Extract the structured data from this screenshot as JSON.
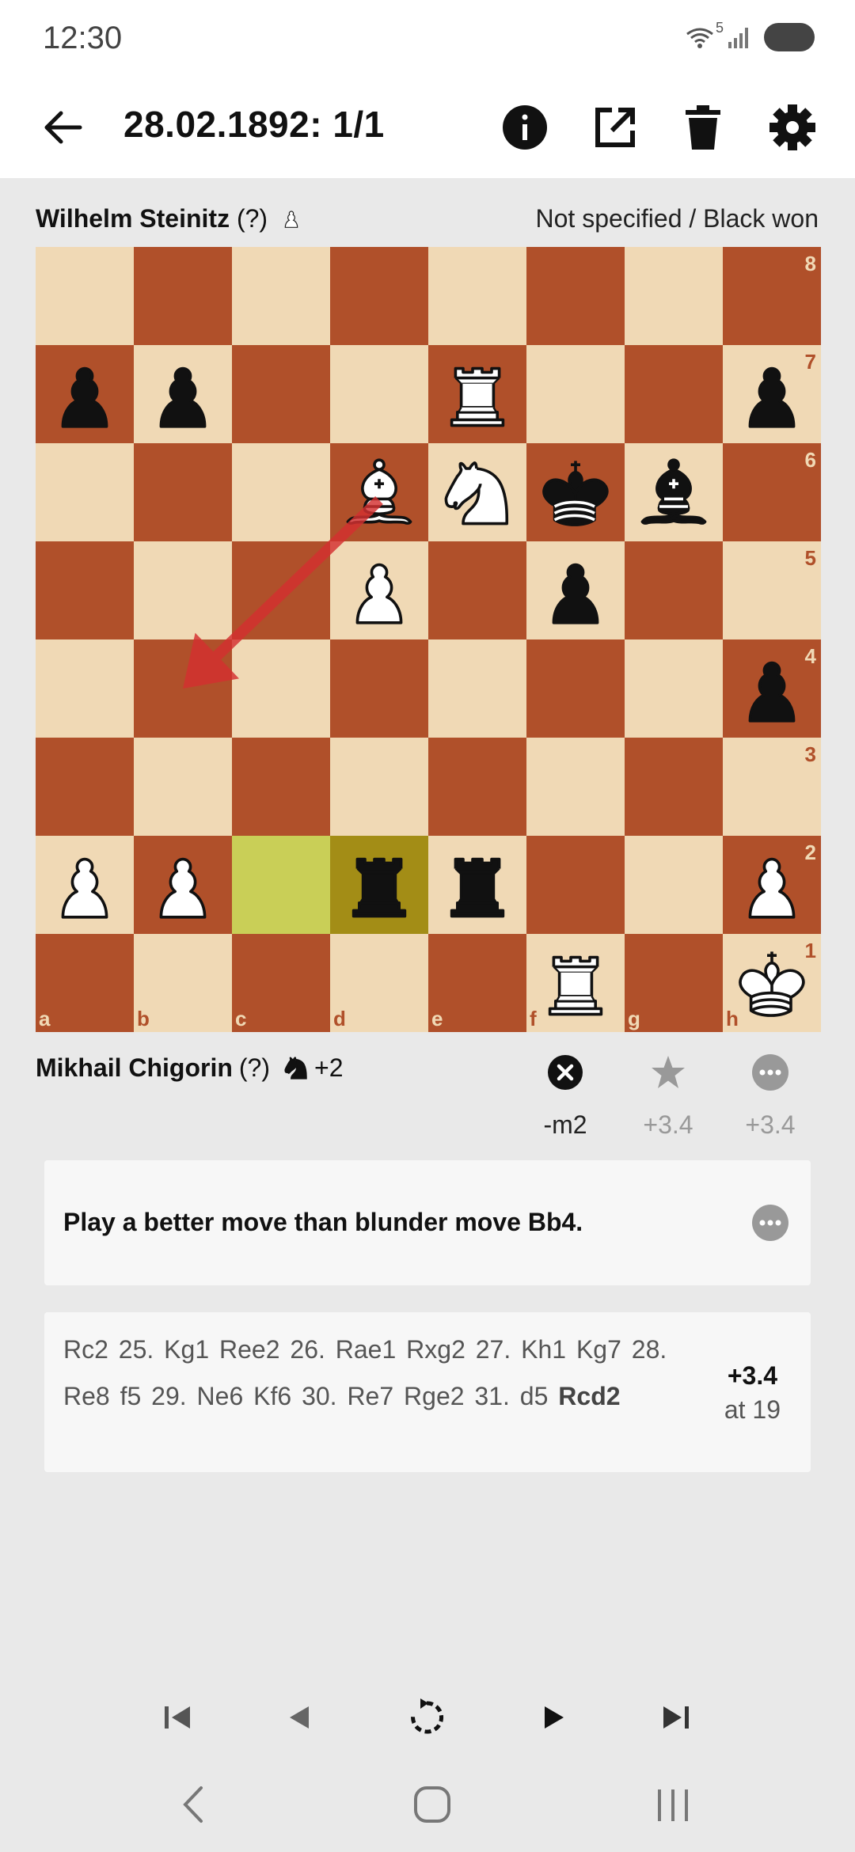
{
  "status": {
    "time": "12:30",
    "wifi_badge": "5"
  },
  "app_bar": {
    "title": "28.02.1892: 1/1",
    "icons": [
      "back-arrow-icon",
      "info-icon",
      "open-external-icon",
      "delete-icon",
      "settings-icon"
    ]
  },
  "top_player": {
    "name": "Wilhelm Steinitz",
    "rating": "(?)",
    "side_icon": "white-pawn-icon"
  },
  "game_result": "Not specified / Black won",
  "board": {
    "files": [
      "a",
      "b",
      "c",
      "d",
      "e",
      "f",
      "g",
      "h"
    ],
    "ranks": [
      "8",
      "7",
      "6",
      "5",
      "4",
      "3",
      "2",
      "1"
    ],
    "pieces": [
      {
        "sq": "a7",
        "p": "bP"
      },
      {
        "sq": "b7",
        "p": "bP"
      },
      {
        "sq": "e7",
        "p": "wR"
      },
      {
        "sq": "h7",
        "p": "bP"
      },
      {
        "sq": "d6",
        "p": "wB"
      },
      {
        "sq": "e6",
        "p": "wN"
      },
      {
        "sq": "f6",
        "p": "bK"
      },
      {
        "sq": "g6",
        "p": "bB"
      },
      {
        "sq": "d5",
        "p": "wP"
      },
      {
        "sq": "f5",
        "p": "bP"
      },
      {
        "sq": "h4",
        "p": "bP"
      },
      {
        "sq": "a2",
        "p": "wP"
      },
      {
        "sq": "b2",
        "p": "wP"
      },
      {
        "sq": "d2",
        "p": "bR"
      },
      {
        "sq": "e2",
        "p": "bR"
      },
      {
        "sq": "h2",
        "p": "wP"
      },
      {
        "sq": "f1",
        "p": "wR"
      },
      {
        "sq": "h1",
        "p": "wK"
      }
    ],
    "last_move": {
      "from": "c2",
      "to": "d2"
    },
    "arrow": {
      "from": "d6",
      "to": "b4",
      "color": "#d32f2f"
    },
    "colors": {
      "light": "#f0d9b5",
      "dark": "#b0502a",
      "hl_from": "#c9cf57",
      "hl_to": "#a38d16",
      "coord_on_light": "#b0502a",
      "coord_on_dark": "#f0d9b5"
    }
  },
  "bottom_player": {
    "name": "Mikhail Chigorin",
    "rating": "(?)",
    "side_icon": "black-knight-icon",
    "material": "+2"
  },
  "evals": [
    {
      "icon": "blunder-icon",
      "value": "-m2"
    },
    {
      "icon": "star-icon",
      "value": "+3.4"
    },
    {
      "icon": "more-icon",
      "value": "+3.4"
    }
  ],
  "hint": {
    "text": "Play a better move than blunder move Bb4."
  },
  "engine_line": {
    "moves": [
      "Rc2",
      "25. Kg1",
      "Ree2",
      "26. Rae1",
      "Rxg2",
      "27. Kh1",
      "Kg7",
      "28. Re8",
      "f5",
      "29. Ne6",
      "Kf6",
      "30. Re7",
      "Rge2",
      "31. d5"
    ],
    "last_move": "Rcd2",
    "score": "+3.4",
    "depth": "at 19"
  },
  "nav": [
    "first-move-icon",
    "previous-move-icon",
    "replay-icon",
    "next-move-icon",
    "last-move-icon"
  ],
  "system_nav": [
    "system-back-icon",
    "home-icon",
    "recents-icon"
  ]
}
